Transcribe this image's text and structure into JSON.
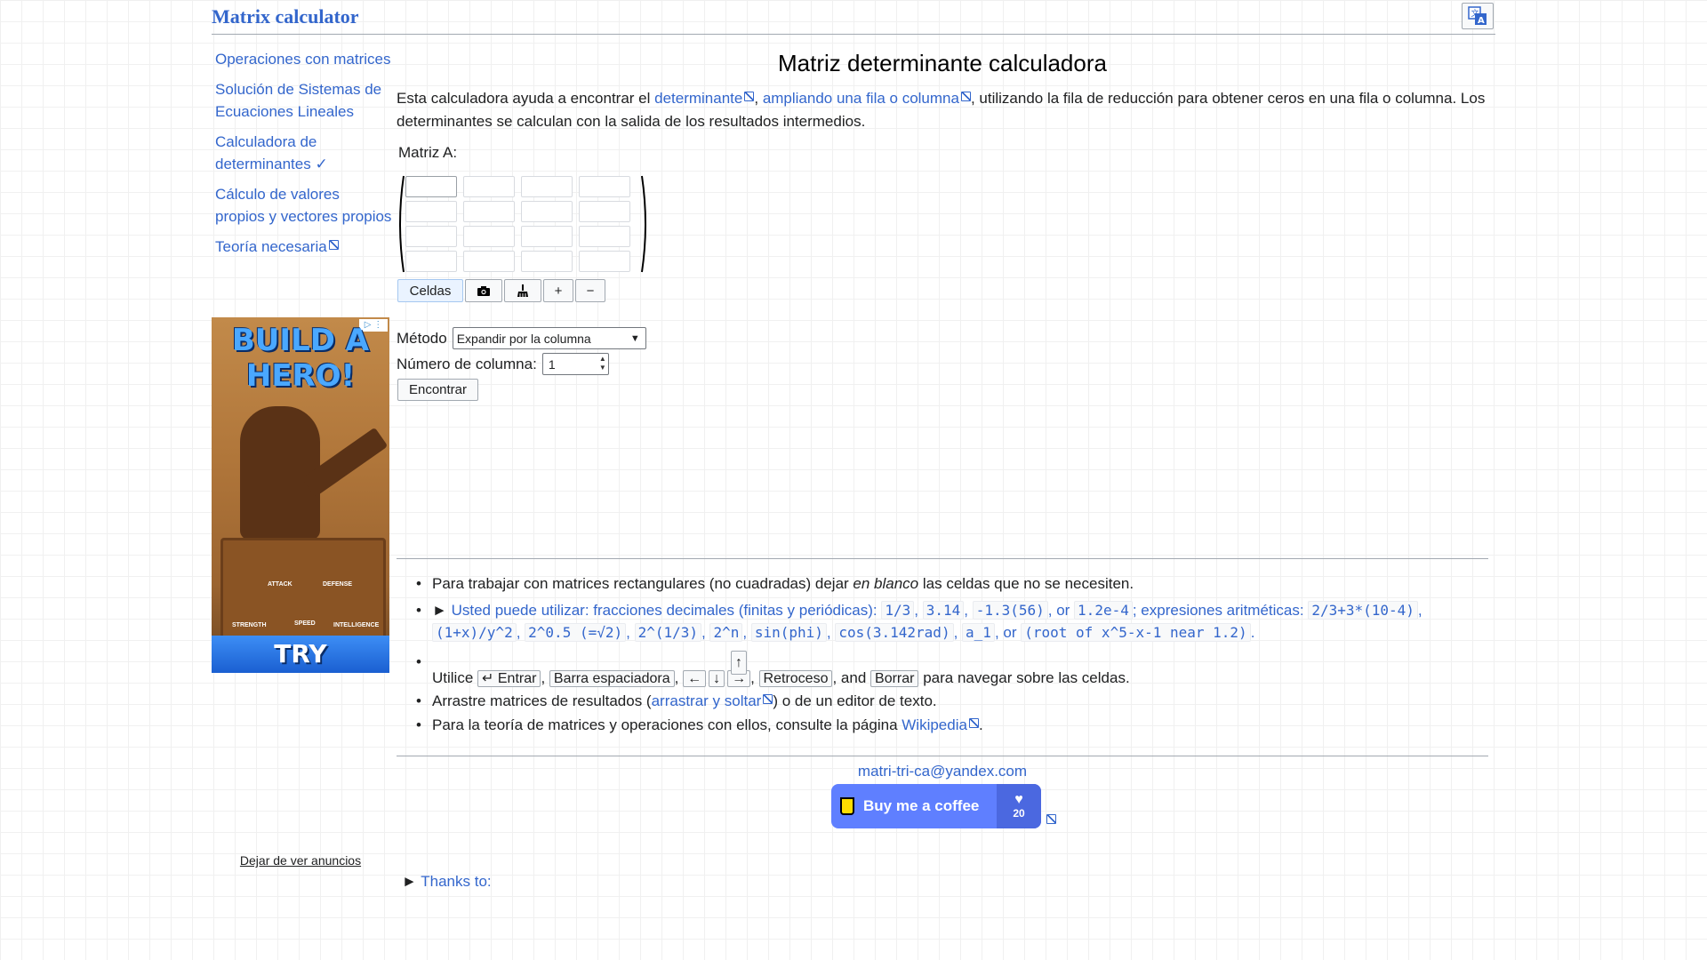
{
  "header": {
    "site_title": "Matrix calculator",
    "language_icon": "translate-icon"
  },
  "sidebar": {
    "items": [
      {
        "label": "Operaciones con matrices"
      },
      {
        "label": "Solución de Sistemas de Ecuaciones Lineales"
      },
      {
        "label": "Calculadora de determinantes ✓"
      },
      {
        "label": "Cálculo de valores propios y vectores propios"
      },
      {
        "label": "Teoría necesaria"
      }
    ],
    "ad": {
      "title": "BUILD A HERO!",
      "stats": [
        "ATTACK",
        "DEFENSE",
        "STRENGTH",
        "SPEED",
        "INTELLIGENCE"
      ],
      "cta": "TRY"
    },
    "stop_ads": "Dejar de ver anuncios"
  },
  "main": {
    "page_title": "Matriz determinante calculadora",
    "intro": {
      "part1": "Esta calculadora ayuda a encontrar el ",
      "link1": "determinante",
      "sep1": ", ",
      "link2": "ampliando una fila o columna",
      "part2": ", utilizando la fila de reducción para obtener ceros en una fila o columna. Los determinantes se calculan con la salida de los resultados intermedios."
    },
    "matrix_label": "Matriz A:",
    "matrix": {
      "rows": 4,
      "cols": 4,
      "values": [
        [
          "",
          "",
          "",
          ""
        ],
        [
          "",
          "",
          "",
          ""
        ],
        [
          "",
          "",
          "",
          ""
        ],
        [
          "",
          "",
          "",
          ""
        ]
      ]
    },
    "toolbar": {
      "cells_label": "Celdas",
      "camera_icon": "camera-icon",
      "clear_icon": "broom-icon",
      "plus_label": "+",
      "minus_label": "−"
    },
    "method_label": "Método",
    "method_value": "Expandir por la columna",
    "column_label": "Número de columna:",
    "column_value": "1",
    "find_label": "Encontrar"
  },
  "notes": {
    "n1_a": "Para trabajar con matrices rectangulares (no cuadradas) dejar ",
    "n1_em": "en blanco",
    "n1_b": " las celdas que no se necesiten.",
    "n2_toggle": "► ",
    "n2_a": "Usted puede utilizar: fracciones decimales (finitas y periódicas): ",
    "n2_c1": "1/3",
    "n2_c2": "3.14",
    "n2_c3": "-1.3(56)",
    "n2_or1": ", or ",
    "n2_c4": "1.2e-4",
    "n2_b": "; expresiones aritméticas: ",
    "n2_c5": "2/3+3*(10-4)",
    "n2_c6": "(1+x)/y^2",
    "n2_c7": "2^0.5 (=√2)",
    "n2_c8": "2^(1/3)",
    "n2_c9": "2^n",
    "n2_c10": "sin(phi)",
    "n2_c11": "cos(3.142rad)",
    "n2_c12": "a_1",
    "n2_or2": ", or ",
    "n2_c13": "(root of x^5-x-1 near 1.2)",
    "n3_a": "Utilice ",
    "n3_k1": "↵ Entrar",
    "n3_k2": "Barra espaciadora",
    "n3_k3": "←",
    "n3_k4": "↓",
    "n3_k5": "→",
    "n3_kup": "↑",
    "n3_k6": "Retroceso",
    "n3_and": ", and ",
    "n3_k7": "Borrar",
    "n3_b": " para navegar sobre las celdas.",
    "n4_a": "Arrastre matrices de resultados (",
    "n4_link": "arrastrar y soltar",
    "n4_b": ") o de un editor de texto.",
    "n5_a": "Para la teoría de matrices y operaciones con ellos, consulte la página ",
    "n5_link": "Wikipedia",
    "n5_b": "."
  },
  "footer": {
    "email": "matri-tri-ca@yandex.com",
    "coffee_label": "Buy me a coffee",
    "coffee_count": "20",
    "thanks_toggle": "► ",
    "thanks_label": "Thanks to:"
  },
  "colors": {
    "link": "#3366cc",
    "border": "#a2a9b1",
    "coffee_bg": "#5f7fff"
  }
}
